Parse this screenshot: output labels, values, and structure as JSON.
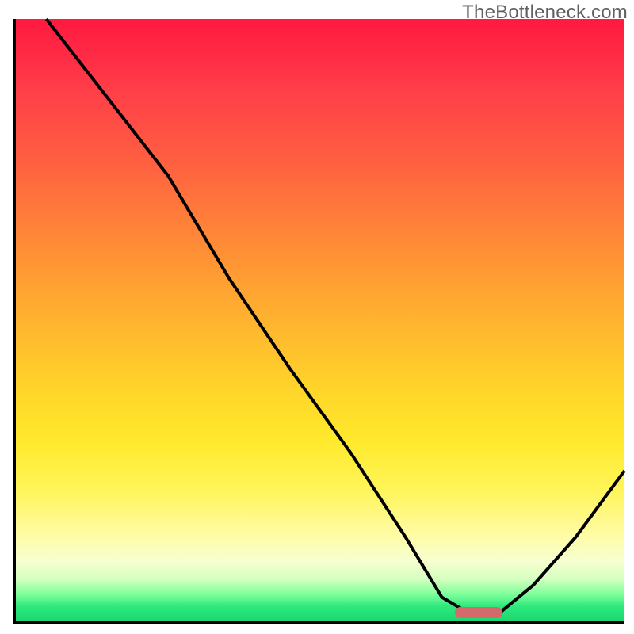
{
  "watermark": "TheBottleneck.com",
  "colors": {
    "axis": "#000000",
    "curve": "#000000",
    "marker": "#d46a6a",
    "gradient_top": "#ff1a3f",
    "gradient_mid": "#ffd62a",
    "gradient_bottom": "#18d86f"
  },
  "chart_data": {
    "type": "line",
    "title": "",
    "xlabel": "",
    "ylabel": "",
    "xlim": [
      0,
      100
    ],
    "ylim": [
      0,
      100
    ],
    "grid": false,
    "legend": false,
    "series": [
      {
        "name": "bottleneck-curve",
        "x": [
          5,
          15,
          25,
          35,
          45,
          55,
          64,
          70,
          75,
          79,
          85,
          92,
          100
        ],
        "values": [
          100,
          87,
          74,
          57,
          42,
          28,
          14,
          4,
          1,
          1,
          6,
          14,
          25
        ]
      }
    ],
    "marker": {
      "x": 76,
      "y": 1.5,
      "shape": "pill"
    },
    "background": "vertical-gradient red→yellow→green (bottleneck severity scale)"
  }
}
